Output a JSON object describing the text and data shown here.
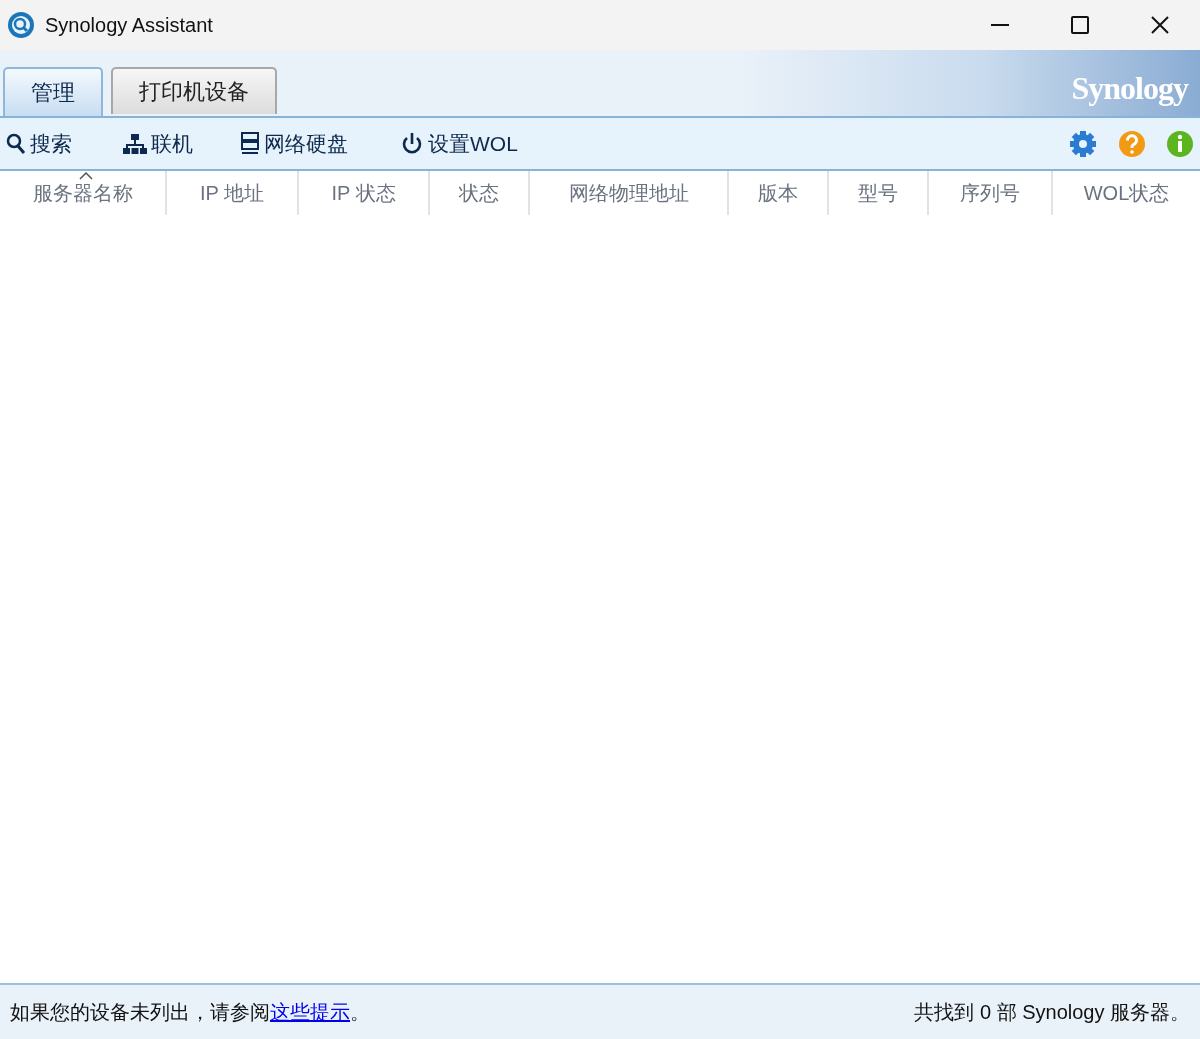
{
  "window": {
    "title": "Synology Assistant"
  },
  "tabs": [
    {
      "label": "管理",
      "selected": true
    },
    {
      "label": "打印机设备",
      "selected": false
    }
  ],
  "logo": "Synology",
  "toolbar": [
    {
      "label": "搜索"
    },
    {
      "label": "联机"
    },
    {
      "label": "网络硬盘"
    },
    {
      "label": "设置WOL"
    }
  ],
  "table": {
    "columns": [
      {
        "label": "服务器名称",
        "sorted": true
      },
      {
        "label": "IP 地址",
        "sorted": false
      },
      {
        "label": "IP 状态",
        "sorted": false
      },
      {
        "label": "状态",
        "sorted": false
      },
      {
        "label": "网络物理地址",
        "sorted": false
      },
      {
        "label": "版本",
        "sorted": false
      },
      {
        "label": "型号",
        "sorted": false
      },
      {
        "label": "序列号",
        "sorted": false
      },
      {
        "label": "WOL状态",
        "sorted": false
      }
    ]
  },
  "status_bar": {
    "hint_prefix": "如果您的设备未列出，请参阅",
    "hint_link": "这些提示",
    "hint_suffix": "。",
    "count": "共找到 0 部 Synology 服务器。"
  }
}
